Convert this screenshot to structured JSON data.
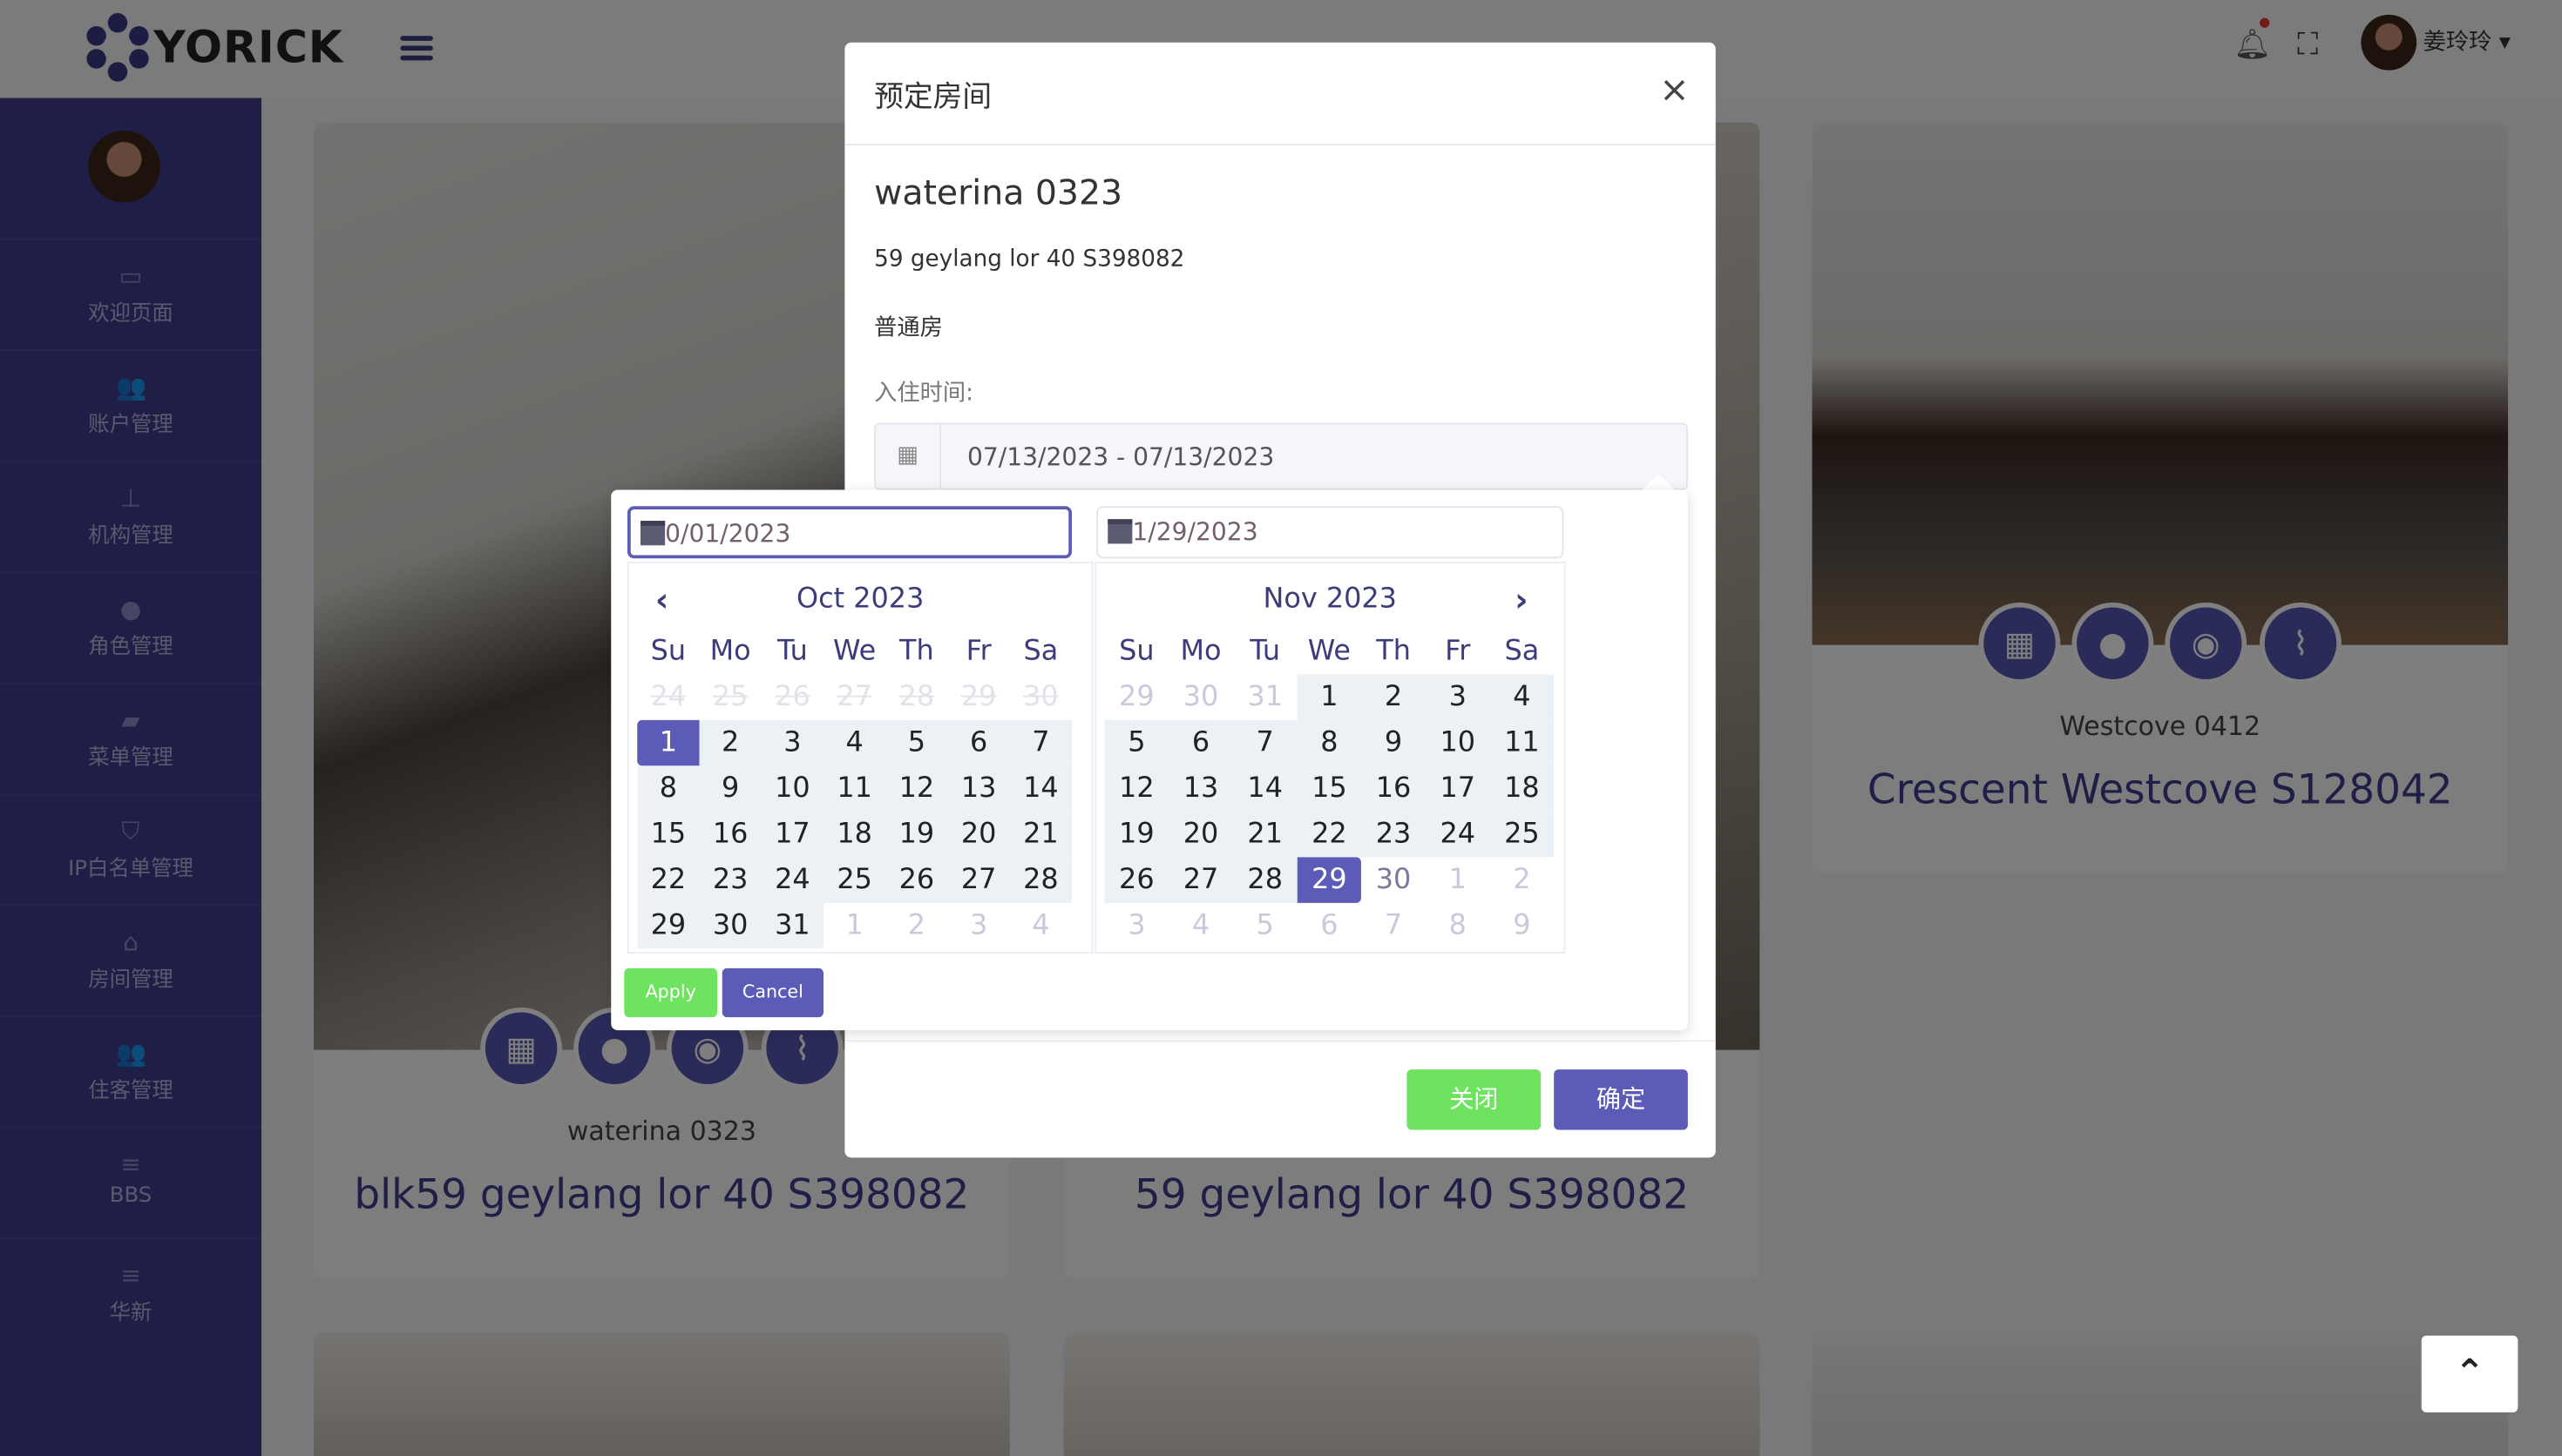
{
  "header": {
    "brand": "YORICK",
    "user_name": "姜玲玲 ▾"
  },
  "sidebar": {
    "items": [
      {
        "label": "欢迎页面",
        "icon": "monitor-icon",
        "glyph": "▭"
      },
      {
        "label": "账户管理",
        "icon": "users-icon",
        "glyph": "👥"
      },
      {
        "label": "机构管理",
        "icon": "sitemap-icon",
        "glyph": "⊥"
      },
      {
        "label": "角色管理",
        "icon": "user-icon",
        "glyph": "●"
      },
      {
        "label": "菜单管理",
        "icon": "folder-icon",
        "glyph": "▰"
      },
      {
        "label": "IP白名单管理",
        "icon": "shield-icon",
        "glyph": "⛉"
      },
      {
        "label": "房间管理",
        "icon": "home-icon",
        "glyph": "⌂"
      },
      {
        "label": "住客管理",
        "icon": "users-icon",
        "glyph": "👥"
      },
      {
        "label": "BBS",
        "icon": "list-icon",
        "glyph": "≡"
      },
      {
        "label": "华新",
        "icon": "list-icon",
        "glyph": "≡"
      }
    ]
  },
  "cards": [
    {
      "subtitle": "waterina 0323",
      "title": "blk59 geylang lor 40 S398082"
    },
    {
      "subtitle": "",
      "title": "59 geylang lor 40 S398082"
    },
    {
      "subtitle": "Westcove 0412",
      "title": "Crescent Westcove S128042"
    }
  ],
  "modal": {
    "title": "预定房间",
    "close": "×",
    "room_name": "waterina 0323",
    "address": "59 geylang lor 40 S398082",
    "room_type": "普通房",
    "checkin_label": "入住时间:",
    "date_range": "07/13/2023 - 07/13/2023",
    "close_button": "关闭",
    "confirm_button": "确定"
  },
  "daterangepicker": {
    "start_input": "0/01/2023",
    "end_input": "1/29/2023",
    "apply": "Apply",
    "cancel": "Cancel",
    "weekdays": [
      "Su",
      "Mo",
      "Tu",
      "We",
      "Th",
      "Fr",
      "Sa"
    ],
    "left": {
      "month": "Oct 2023",
      "cells": [
        {
          "d": "24",
          "s": "disabled"
        },
        {
          "d": "25",
          "s": "disabled"
        },
        {
          "d": "26",
          "s": "disabled"
        },
        {
          "d": "27",
          "s": "disabled"
        },
        {
          "d": "28",
          "s": "disabled"
        },
        {
          "d": "29",
          "s": "disabled"
        },
        {
          "d": "30",
          "s": "disabled"
        },
        {
          "d": "1",
          "s": "start"
        },
        {
          "d": "2",
          "s": "range"
        },
        {
          "d": "3",
          "s": "range"
        },
        {
          "d": "4",
          "s": "range"
        },
        {
          "d": "5",
          "s": "range"
        },
        {
          "d": "6",
          "s": "range"
        },
        {
          "d": "7",
          "s": "range"
        },
        {
          "d": "8",
          "s": "range"
        },
        {
          "d": "9",
          "s": "range"
        },
        {
          "d": "10",
          "s": "range"
        },
        {
          "d": "11",
          "s": "range"
        },
        {
          "d": "12",
          "s": "range"
        },
        {
          "d": "13",
          "s": "range"
        },
        {
          "d": "14",
          "s": "range"
        },
        {
          "d": "15",
          "s": "range"
        },
        {
          "d": "16",
          "s": "range"
        },
        {
          "d": "17",
          "s": "range"
        },
        {
          "d": "18",
          "s": "range"
        },
        {
          "d": "19",
          "s": "range"
        },
        {
          "d": "20",
          "s": "range"
        },
        {
          "d": "21",
          "s": "range"
        },
        {
          "d": "22",
          "s": "range"
        },
        {
          "d": "23",
          "s": "range"
        },
        {
          "d": "24",
          "s": "range"
        },
        {
          "d": "25",
          "s": "range"
        },
        {
          "d": "26",
          "s": "range"
        },
        {
          "d": "27",
          "s": "range"
        },
        {
          "d": "28",
          "s": "range"
        },
        {
          "d": "29",
          "s": "range"
        },
        {
          "d": "30",
          "s": "range"
        },
        {
          "d": "31",
          "s": "range"
        },
        {
          "d": "1",
          "s": "off"
        },
        {
          "d": "2",
          "s": "off"
        },
        {
          "d": "3",
          "s": "off"
        },
        {
          "d": "4",
          "s": "off"
        }
      ]
    },
    "right": {
      "month": "Nov 2023",
      "cells": [
        {
          "d": "29",
          "s": "off"
        },
        {
          "d": "30",
          "s": "off"
        },
        {
          "d": "31",
          "s": "off"
        },
        {
          "d": "1",
          "s": "range"
        },
        {
          "d": "2",
          "s": "range"
        },
        {
          "d": "3",
          "s": "range"
        },
        {
          "d": "4",
          "s": "range"
        },
        {
          "d": "5",
          "s": "range"
        },
        {
          "d": "6",
          "s": "range"
        },
        {
          "d": "7",
          "s": "range"
        },
        {
          "d": "8",
          "s": "range"
        },
        {
          "d": "9",
          "s": "range"
        },
        {
          "d": "10",
          "s": "range"
        },
        {
          "d": "11",
          "s": "range"
        },
        {
          "d": "12",
          "s": "range"
        },
        {
          "d": "13",
          "s": "range"
        },
        {
          "d": "14",
          "s": "range"
        },
        {
          "d": "15",
          "s": "range"
        },
        {
          "d": "16",
          "s": "range"
        },
        {
          "d": "17",
          "s": "range"
        },
        {
          "d": "18",
          "s": "range"
        },
        {
          "d": "19",
          "s": "range"
        },
        {
          "d": "20",
          "s": "range"
        },
        {
          "d": "21",
          "s": "range"
        },
        {
          "d": "22",
          "s": "range"
        },
        {
          "d": "23",
          "s": "range"
        },
        {
          "d": "24",
          "s": "range"
        },
        {
          "d": "25",
          "s": "range"
        },
        {
          "d": "26",
          "s": "range"
        },
        {
          "d": "27",
          "s": "range"
        },
        {
          "d": "28",
          "s": "range"
        },
        {
          "d": "29",
          "s": "end"
        },
        {
          "d": "30",
          "s": "muted"
        },
        {
          "d": "1",
          "s": "off"
        },
        {
          "d": "2",
          "s": "off"
        },
        {
          "d": "3",
          "s": "off"
        },
        {
          "d": "4",
          "s": "off"
        },
        {
          "d": "5",
          "s": "off"
        },
        {
          "d": "6",
          "s": "off"
        },
        {
          "d": "7",
          "s": "off"
        },
        {
          "d": "8",
          "s": "off"
        },
        {
          "d": "9",
          "s": "off"
        }
      ]
    }
  },
  "colors": {
    "primary": "#5c5cb8",
    "success": "#6ee35f",
    "sidebar": "#3c3c8c"
  }
}
